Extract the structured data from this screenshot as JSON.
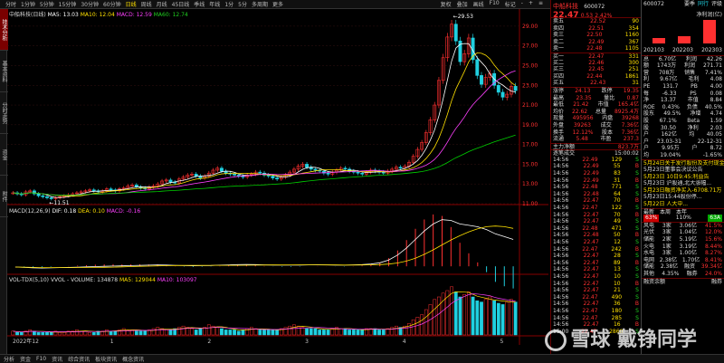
{
  "toolbar": {
    "items": [
      "分时",
      "1分钟",
      "5分钟",
      "15分钟",
      "30分钟",
      "60分钟",
      "日线",
      "周线",
      "月线",
      "45日线",
      "季线",
      "年线",
      "1分",
      "5分",
      "多周期",
      "更多"
    ],
    "active_index": 6,
    "right_items": [
      "复权",
      "叠加",
      "画线",
      "F10",
      "标记",
      "-",
      "+",
      "≡"
    ]
  },
  "left_side": [
    "技术分析",
    "基本资料",
    "分时走势",
    "资金",
    "附件"
  ],
  "main_legend": {
    "stock": "中船科技(日线)",
    "ma5": "MA5: 13.03",
    "ma10": "MA10: 12.04",
    "macd_tag": "MACD: 12.59",
    "ma60": "MA60: 12.74",
    "colors": {
      "ma5": "#ffffff",
      "ma10": "#ffe000",
      "ma20": "#ff40ff",
      "ma60": "#00d000"
    }
  },
  "price_axis": [
    "29.00",
    "27.00",
    "25.00",
    "23.00",
    "21.00",
    "19.00",
    "17.00",
    "15.00",
    "13.00",
    "11.00"
  ],
  "price_labels": {
    "high": "29.53",
    "low": "11.51"
  },
  "macd_legend": {
    "title": "MACD(12,26,9)",
    "dif": "DIF: 0.18",
    "dea": "DEA: 0.10",
    "macd": "MACD: -0.16"
  },
  "vol_legend": {
    "title": "VOL-TDX(5,10)",
    "vvol": "VVOL - VOLUME: 134878",
    "ma5": "MA5: 129044",
    "ma10": "MA10: 103097"
  },
  "time_axis": [
    "2022年12",
    "1",
    "2",
    "3",
    "4",
    "5"
  ],
  "info": {
    "name": "中船科技",
    "code": "600072",
    "price": "22.47",
    "change": "0.53",
    "pct": "2.42%",
    "order_book": [
      {
        "label": "卖五",
        "price": "22.52",
        "vol": "90"
      },
      {
        "label": "卖四",
        "price": "22.51",
        "vol": "354"
      },
      {
        "label": "卖三",
        "price": "22.50",
        "vol": "1160"
      },
      {
        "label": "卖二",
        "price": "22.49",
        "vol": "367"
      },
      {
        "label": "卖一",
        "price": "22.48",
        "vol": "1105"
      },
      {
        "label": "买一",
        "price": "22.47",
        "vol": "331"
      },
      {
        "label": "买二",
        "price": "22.46",
        "vol": "300"
      },
      {
        "label": "买三",
        "price": "22.45",
        "vol": "251"
      },
      {
        "label": "买四",
        "price": "22.44",
        "vol": "1861"
      },
      {
        "label": "买五",
        "price": "22.43",
        "vol": "31"
      }
    ],
    "stats": [
      [
        "涨停",
        "24.13",
        "跌停",
        "19.35"
      ],
      [
        "最高",
        "23.35",
        "量比",
        "0.87"
      ],
      [
        "最低",
        "21.42",
        "市值",
        "165.4亿"
      ],
      [
        "均价",
        "22.62",
        "总量",
        "8925.4万"
      ],
      [
        "现量",
        "495956",
        "内盘",
        "39268"
      ],
      [
        "外盘",
        "39263",
        "成交",
        "7.36亿"
      ],
      [
        "换手",
        "12.12%",
        "股本",
        "7.36亿"
      ],
      [
        "流通",
        "5.48",
        "市盈",
        "237.3"
      ]
    ],
    "flow_label": "主力净额",
    "flow_value": "823.7万",
    "trade_title": "逐笔成交",
    "trade_time": "15:00:02",
    "trades": [
      [
        "14:56",
        "22.49",
        "129",
        "S"
      ],
      [
        "14:56",
        "22.49",
        "55",
        "B"
      ],
      [
        "14:56",
        "22.49",
        "83",
        "S"
      ],
      [
        "14:56",
        "22.49",
        "31",
        "B"
      ],
      [
        "14:56",
        "22.48",
        "771",
        "S"
      ],
      [
        "14:56",
        "22.48",
        "64",
        "S"
      ],
      [
        "14:56",
        "22.47",
        "70",
        "B"
      ],
      [
        "14:56",
        "22.47",
        "122",
        "S"
      ],
      [
        "14:56",
        "22.47",
        "70",
        "B"
      ],
      [
        "14:56",
        "22.47",
        "49",
        "S"
      ],
      [
        "14:56",
        "22.48",
        "471",
        "S"
      ],
      [
        "14:56",
        "22.48",
        "50",
        "B"
      ],
      [
        "14:56",
        "22.47",
        "12",
        "S"
      ],
      [
        "14:56",
        "22.47",
        "242",
        "B"
      ],
      [
        "14:56",
        "22.47",
        "28",
        "S"
      ],
      [
        "14:56",
        "22.47",
        "89",
        "B"
      ],
      [
        "14:56",
        "22.47",
        "13",
        "S"
      ],
      [
        "14:56",
        "22.47",
        "10",
        "S"
      ],
      [
        "14:56",
        "22.47",
        "10",
        "B"
      ],
      [
        "14:56",
        "22.47",
        "21",
        "S"
      ],
      [
        "14:56",
        "22.47",
        "490",
        "S"
      ],
      [
        "14:56",
        "22.47",
        "36",
        "B"
      ],
      [
        "14:56",
        "22.47",
        "180",
        "S"
      ],
      [
        "14:56",
        "22.47",
        "285",
        "S"
      ],
      [
        "14:56",
        "22.47",
        "16",
        "B"
      ],
      [
        "15:00",
        "22.47",
        "2860",
        "S"
      ]
    ]
  },
  "far": {
    "code": "600072",
    "tabs": [
      "要季",
      "同行",
      "评级"
    ],
    "eps_title": "净利润(亿)",
    "bars_years": [
      "202103",
      "202203",
      "202303"
    ],
    "fin": [
      [
        "总",
        "6.70亿",
        "利润",
        "42.26"
      ],
      [
        "额",
        "1743万",
        "利润",
        "271.71"
      ],
      [
        "营",
        "708万",
        "销售",
        "7.41%"
      ],
      [
        "利",
        "9.67亿",
        "毛利",
        "4.08"
      ],
      [
        "PE",
        "131.7",
        "PB",
        "4.00"
      ],
      [
        "每",
        "-6.33",
        "PS",
        "0.08"
      ],
      [
        "净",
        "13.37",
        "市值",
        "8.84"
      ],
      [
        "ROE",
        "0.43%",
        "负债",
        "40.5%"
      ],
      [
        "股东",
        "49.5%",
        "净增",
        "4.74"
      ],
      [
        "股",
        "67.1%",
        "Beta",
        "1.59"
      ],
      [
        "股",
        "30.50",
        "净利",
        "2.03"
      ],
      [
        "户",
        "162亿",
        "均",
        "40.05"
      ],
      [
        "户",
        "23.03-31",
        "",
        "22-12-31"
      ],
      [
        "户",
        "9.95万",
        "户",
        "8.72"
      ],
      [
        "均",
        "19.04%",
        "",
        "-1.65%"
      ]
    ],
    "news": [
      "5月24日关于发行股份及支付现金...",
      "5月23日董事会决议公告",
      "5月23日 10日9:45:利益告",
      "5月23日 沪股通,北大涨幅...",
      "5月23日融资净买入-6708.71万",
      "5月23日15:44股份停...",
      "5月22日 人大中..."
    ],
    "tags": [
      "最新",
      "本周",
      "本年"
    ],
    "chips": {
      "left": "63%",
      "right": "63A",
      "mid": "110%"
    },
    "sector": [
      [
        "风电",
        "3家",
        "3.06亿",
        "41.5%"
      ],
      [
        "光伏",
        "3家",
        "1.04亿",
        "12.0%"
      ],
      [
        "储能",
        "2家",
        "5.19亿",
        "15.6%"
      ],
      [
        "火电",
        "1家",
        "3.19亿",
        "8.44%"
      ],
      [
        "水电",
        "3家",
        "1.00亿",
        "8.27%"
      ],
      [
        "电网",
        "2.38亿",
        "1.70亿",
        "8.41%"
      ],
      [
        "储能",
        "2.38亿",
        "融资",
        "39.34亿"
      ],
      [
        "其他",
        "4.35%",
        "融券",
        "24.0%"
      ]
    ],
    "sector_head": [
      "融资余额",
      "融券"
    ]
  },
  "bottom": [
    "分析",
    "资金",
    "F10",
    "资讯",
    "综合资讯",
    "板块资讯",
    "概念资讯"
  ],
  "watermark": "雪球  戴铮同学",
  "chart_data": {
    "type": "candlestick",
    "title": "中船科技(日线)",
    "note": "Daily K-line approx Dec 2022 - May 2023",
    "close": [
      12.1,
      12.0,
      11.9,
      12.2,
      12.3,
      12.0,
      11.8,
      11.7,
      11.6,
      11.5,
      11.6,
      11.7,
      11.8,
      11.9,
      12.0,
      12.1,
      12.2,
      12.3,
      12.4,
      12.3,
      12.2,
      12.3,
      12.5,
      12.4,
      12.3,
      12.5,
      12.6,
      12.8,
      12.9,
      12.7,
      12.6,
      12.5,
      12.7,
      12.8,
      13.0,
      13.3,
      13.4,
      13.2,
      13.1,
      13.5,
      13.7,
      13.9,
      14.0,
      13.8,
      13.6,
      13.8,
      14.1,
      14.4,
      14.6,
      14.3,
      14.1,
      14.0,
      13.9,
      13.8,
      13.7,
      13.9,
      14.0,
      14.2,
      14.1,
      13.9,
      13.8,
      13.6,
      13.5,
      13.7,
      13.9,
      14.2,
      14.5,
      14.8,
      15.0,
      14.7,
      14.5,
      14.4,
      14.3,
      14.1,
      14.0,
      14.2,
      14.4,
      14.6,
      14.5,
      14.3,
      14.2,
      14.1,
      14.0,
      14.2,
      14.4,
      14.3,
      14.2,
      14.1,
      14.3,
      14.5,
      14.7,
      14.6,
      14.8,
      15.2,
      15.8,
      16.5,
      17.2,
      18.2,
      19.5,
      21.0,
      23.5,
      25.8,
      27.9,
      29.2,
      27.5,
      25.4,
      26.2,
      27.8,
      25.6,
      24.0,
      23.1,
      23.8,
      24.2,
      23.0,
      22.3,
      21.8,
      22.1,
      22.9,
      22.47
    ],
    "macd_dif": [
      -0.05,
      -0.08,
      -0.1,
      -0.12,
      -0.11,
      -0.09,
      -0.08,
      -0.06,
      -0.04,
      -0.02,
      0,
      0.02,
      0.03,
      0.05,
      0.07,
      0.08,
      0.1,
      0.09,
      0.07,
      0.05,
      0.04,
      0.05,
      0.06,
      0.08,
      0.1,
      0.12,
      0.13,
      0.12,
      0.1,
      0.09,
      0.08,
      0.08,
      0.09,
      0.1,
      0.11,
      0.1,
      0.09,
      0.08,
      0.1,
      0.12,
      0.16,
      0.25,
      0.45,
      0.8,
      1.3,
      1.9,
      2.5,
      3.0,
      3.3,
      3.25,
      3.0,
      2.9,
      2.8,
      2.6,
      2.3,
      2.1,
      1.9
    ],
    "volume": [
      3,
      2,
      2,
      3,
      4,
      3,
      2,
      2,
      2,
      2,
      3,
      2,
      2,
      3,
      3,
      4,
      3,
      3,
      2,
      2,
      3,
      3,
      4,
      3,
      3,
      4,
      5,
      4,
      4,
      3,
      3,
      3,
      4,
      5,
      6,
      5,
      4,
      4,
      5,
      6,
      7,
      6,
      5,
      4,
      5,
      6,
      8,
      7,
      6,
      5,
      4,
      4,
      4,
      3,
      4,
      5,
      6,
      5,
      4,
      4,
      4,
      4,
      4,
      5,
      6,
      7,
      8,
      7,
      6,
      5,
      5,
      5,
      4,
      4,
      4,
      5,
      6,
      5,
      5,
      4,
      4,
      4,
      4,
      5,
      5,
      5,
      4,
      4,
      5,
      6,
      7,
      6,
      7,
      9,
      12,
      14,
      16,
      20,
      24,
      28,
      30,
      33,
      35,
      38,
      34,
      30,
      32,
      34,
      30,
      27,
      26,
      28,
      30,
      27,
      25,
      24,
      26,
      28,
      26
    ]
  }
}
